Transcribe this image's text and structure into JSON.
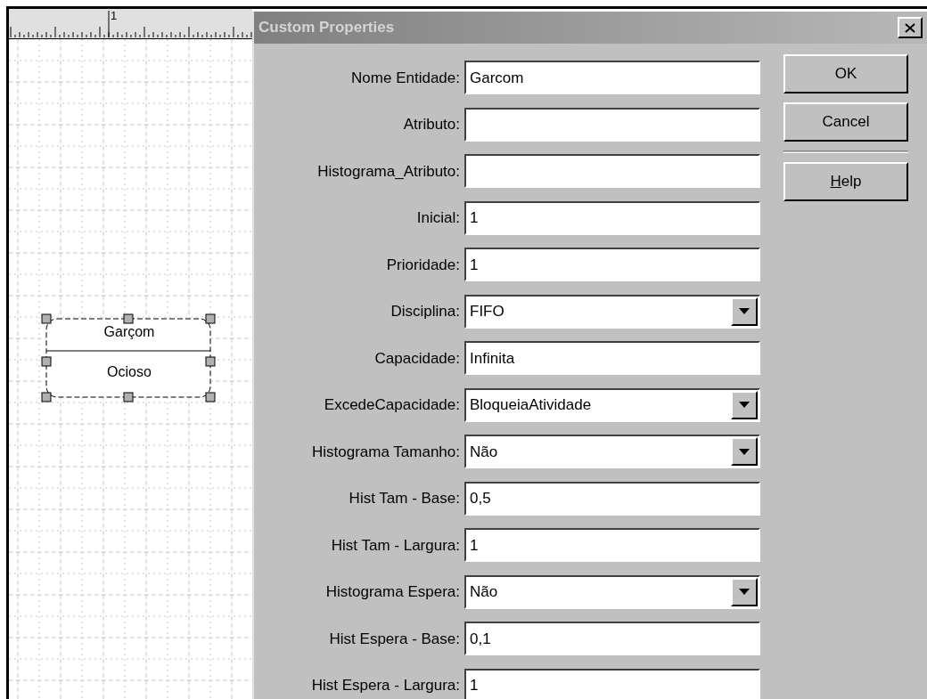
{
  "canvas": {
    "ruler_mark": "1",
    "entity": {
      "name": "Garçom",
      "state": "Ocioso"
    }
  },
  "dialog": {
    "title": "Custom Properties",
    "fields": [
      {
        "kind": "text",
        "label": "Nome Entidade:",
        "value": "Garcom"
      },
      {
        "kind": "text",
        "label": "Atributo:"
      },
      {
        "kind": "text",
        "label": "Histograma_Atributo:"
      },
      {
        "kind": "text",
        "label": "Inicial:",
        "value": "1"
      },
      {
        "kind": "text",
        "label": "Prioridade:",
        "value": "1"
      },
      {
        "kind": "select",
        "label": "Disciplina:",
        "value": "FIFO"
      },
      {
        "kind": "text",
        "label": "Capacidade:",
        "value": "Infinita"
      },
      {
        "kind": "select",
        "label": "ExcedeCapacidade:",
        "value": "BloqueiaAtividade"
      },
      {
        "kind": "select",
        "label": "Histograma Tamanho:",
        "value": "Não"
      },
      {
        "kind": "text",
        "label": "Hist Tam - Base:",
        "value": "0,5"
      },
      {
        "kind": "text",
        "label": "Hist Tam - Largura:",
        "value": "1"
      },
      {
        "kind": "select",
        "label": "Histograma Espera:",
        "value": "Não"
      },
      {
        "kind": "text",
        "label": "Hist Espera - Base:",
        "value": "0,1"
      },
      {
        "kind": "text",
        "label": "Hist Espera - Largura:",
        "value": "1"
      }
    ],
    "buttons": [
      {
        "kind": "button",
        "label": "OK",
        "mnemonic": false
      },
      {
        "kind": "button",
        "label": "Cancel",
        "mnemonic": false
      },
      {
        "kind": "separator"
      },
      {
        "kind": "button",
        "label": "Help",
        "mnemonic": true
      }
    ]
  }
}
